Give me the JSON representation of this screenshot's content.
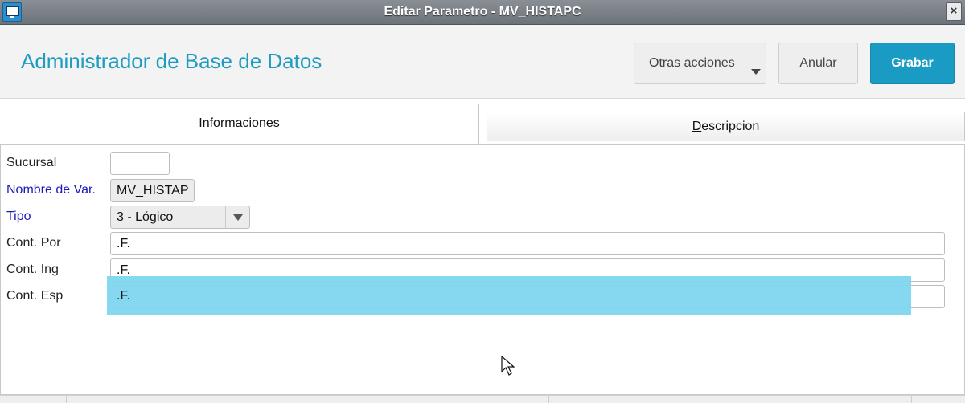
{
  "window": {
    "title": "Editar Parametro - MV_HISTAPC",
    "close_label": "×",
    "icon": "app-window-icon"
  },
  "header": {
    "title": "Administrador de Base de Datos",
    "actions": {
      "more_label": "Otras acciones",
      "cancel_label": "Anular",
      "save_label": "Grabar"
    },
    "accent_color": "#1a9bc4"
  },
  "tabs": {
    "info": {
      "label_first": "I",
      "label_rest": "nformaciones"
    },
    "desc": {
      "label_first": "D",
      "label_rest": "escripcion"
    }
  },
  "form": {
    "sucursal": {
      "label": "Sucursal",
      "value": ""
    },
    "nombre_var": {
      "label": "Nombre de Var.",
      "value": "MV_HISTAP"
    },
    "tipo": {
      "label": "Tipo",
      "value": "3 - Lógico"
    },
    "cont_por": {
      "label": "Cont. Por",
      "value": ".F."
    },
    "cont_ing": {
      "label": "Cont. Ing",
      "value": ".F."
    },
    "cont_esp": {
      "label": "Cont. Esp",
      "value": ".F."
    }
  },
  "highlight_color": "#7fd6ef"
}
